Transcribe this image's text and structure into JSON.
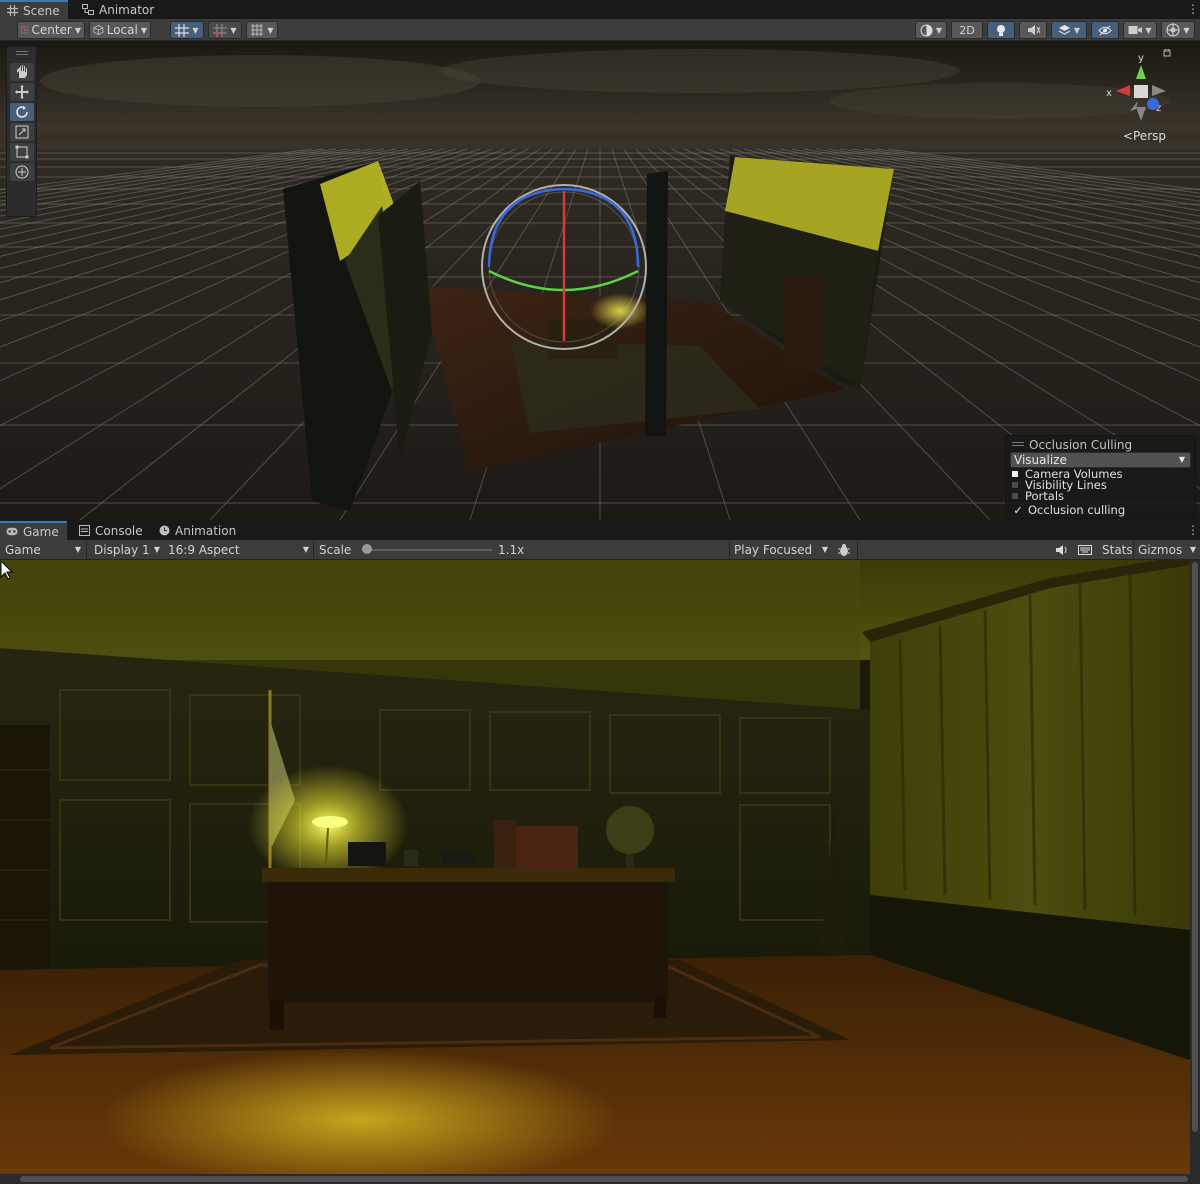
{
  "scene_tabs": [
    {
      "label": "Scene",
      "icon": "grid-icon"
    },
    {
      "label": "Animator",
      "icon": "animator-icon"
    }
  ],
  "scene_toolbar": {
    "pivot_mode": "Center",
    "pivot_rotation": "Local",
    "btn_2d": "2D"
  },
  "scene_view": {
    "projection_label": "Persp",
    "axis_x": "x",
    "axis_y": "y",
    "axis_z": "z"
  },
  "occlusion_panel": {
    "title": "Occlusion Culling",
    "mode": "Visualize",
    "items": [
      {
        "label": "Camera Volumes",
        "swatch": "#f2f2f2"
      },
      {
        "label": "Visibility Lines",
        "swatch": "#4a4a4a"
      },
      {
        "label": "Portals",
        "swatch": "#4a4a4a"
      }
    ],
    "checkbox_label": "Occlusion culling",
    "checkbox_checked": true
  },
  "game_tabs": [
    {
      "label": "Game",
      "icon": "gamepad-icon"
    },
    {
      "label": "Console",
      "icon": "console-icon"
    },
    {
      "label": "Animation",
      "icon": "clock-icon"
    }
  ],
  "game_toolbar": {
    "view_select": "Game",
    "display_select": "Display 1",
    "aspect_select": "16:9 Aspect",
    "scale_label": "Scale",
    "scale_value": "1.1x",
    "scale_fraction": 0.0,
    "play_mode": "Play Focused",
    "stats_label": "Stats",
    "gizmos_label": "Gizmos"
  },
  "colors": {
    "accent": "#3a79bb",
    "panel": "#3c3c3c",
    "selected": "#46607c",
    "light_yellow": "#c8c12a"
  }
}
